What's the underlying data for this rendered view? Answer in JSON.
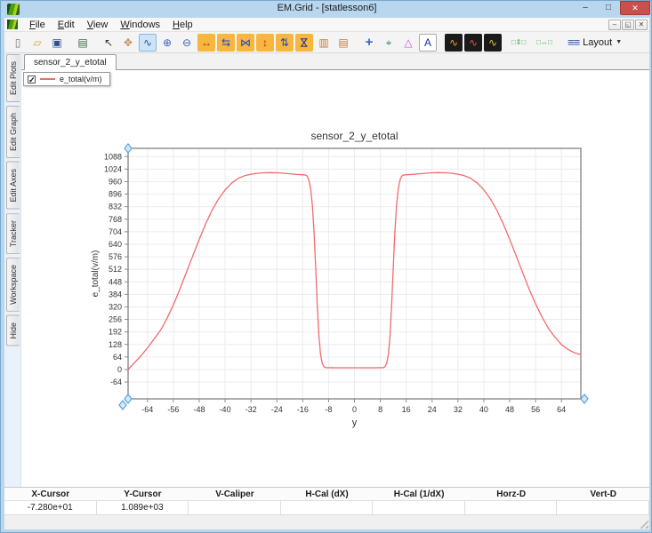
{
  "window": {
    "title": "EM.Grid - [statlesson6]"
  },
  "titlebar": {
    "buttons": [
      {
        "name": "minimize-button",
        "glyph": "–"
      },
      {
        "name": "maximize-button",
        "glyph": "□"
      },
      {
        "name": "close-button",
        "glyph": "✕",
        "close": true
      }
    ]
  },
  "menubar": {
    "items": [
      {
        "label": "File"
      },
      {
        "label": "Edit"
      },
      {
        "label": "View"
      },
      {
        "label": "Windows"
      },
      {
        "label": "Help"
      }
    ],
    "mdi_buttons": [
      {
        "name": "mdi-minimize-button",
        "glyph": "–"
      },
      {
        "name": "mdi-restore-button",
        "glyph": "◱"
      },
      {
        "name": "mdi-close-button",
        "glyph": "✕"
      }
    ]
  },
  "toolbar": {
    "layout_label": "Layout",
    "items": [
      {
        "name": "new-file-icon",
        "glyph": "▯",
        "fg": "#777777"
      },
      {
        "name": "open-folder-icon",
        "glyph": "▱",
        "fg": "#d9a43a"
      },
      {
        "name": "save-icon",
        "glyph": "▣",
        "fg": "#2f4f8f"
      },
      {
        "sep": true
      },
      {
        "name": "print-icon",
        "glyph": "▤",
        "fg": "#356f45"
      },
      {
        "sep": true
      },
      {
        "name": "pointer-icon",
        "glyph": "↖",
        "fg": "#333333"
      },
      {
        "name": "pan-hand-icon",
        "glyph": "✥",
        "fg": "#c09060"
      },
      {
        "name": "zoom-window-icon",
        "glyph": "∿",
        "fg": "#2255aa",
        "sel": true
      },
      {
        "name": "zoom-in-icon",
        "glyph": "⊕",
        "fg": "#3366bb"
      },
      {
        "name": "zoom-out-icon",
        "glyph": "⊖",
        "fg": "#3366bb"
      },
      {
        "name": "h-expand-icon",
        "glyph": "↔",
        "fg": "#bb2222",
        "bg": "#f6b73c"
      },
      {
        "name": "h-arrows-icon",
        "glyph": "⇆",
        "fg": "#2244cc",
        "bg": "#f6b73c"
      },
      {
        "name": "h-compress-icon",
        "glyph": "⋈",
        "fg": "#2244cc",
        "bg": "#f6b73c"
      },
      {
        "name": "v-expand-icon",
        "glyph": "↕",
        "fg": "#bb2222",
        "bg": "#f6b73c"
      },
      {
        "name": "v-arrows-icon",
        "glyph": "⇅",
        "fg": "#2244cc",
        "bg": "#f6b73c"
      },
      {
        "name": "v-compress-icon",
        "glyph": "⋈",
        "fg": "#223388",
        "bg": "#f6b73c",
        "rot": 90
      },
      {
        "name": "v-panels-icon",
        "glyph": "▥",
        "fg": "#cc7733"
      },
      {
        "name": "h-panels-icon",
        "glyph": "▤",
        "fg": "#cc7733"
      },
      {
        "sep": true
      },
      {
        "name": "crosshair-icon",
        "glyph": "+",
        "fg": "#3366cc",
        "big": true
      },
      {
        "name": "tracker-axes-icon",
        "glyph": "⌖",
        "fg": "#2a8a4a"
      },
      {
        "name": "caliper-triangle-icon",
        "glyph": "△",
        "fg": "#cc55cc"
      },
      {
        "name": "text-label-icon",
        "glyph": "A",
        "fg": "#223388",
        "bg": "#ffffff",
        "border": "#aaaaaa"
      },
      {
        "sep": true
      },
      {
        "name": "copy-plot-icon",
        "glyph": "∿",
        "fg": "#f0a030",
        "bg": "#1a1a1a"
      },
      {
        "name": "plot-red-icon",
        "glyph": "∿",
        "fg": "#e05555",
        "bg": "#1a1a1a"
      },
      {
        "name": "plot-yellow-icon",
        "glyph": "∿",
        "fg": "#d8c84a",
        "bg": "#1a1a1a"
      },
      {
        "sep": true
      },
      {
        "name": "v-spacing-icon",
        "glyph": "□⇕□",
        "fg": "#44aa44",
        "small": true
      },
      {
        "sep": true
      },
      {
        "name": "h-spacing-icon",
        "glyph": "□↔□",
        "fg": "#44aa44",
        "small": true
      },
      {
        "sep": true
      }
    ]
  },
  "tabs": {
    "active": "sensor_2_y_etotal"
  },
  "sidebar": {
    "items": [
      "Edit Plots",
      "Edit Graph",
      "Edit Axes",
      "Tracker",
      "Workspace",
      "Hide"
    ]
  },
  "legend": {
    "checked": "✓",
    "label": "e_total(v/m)",
    "line_color": "#f26b6b"
  },
  "chart_data": {
    "type": "line",
    "title": "sensor_2_y_etotal",
    "xlabel": "y",
    "ylabel": "e_total(v/m)",
    "xlim": [
      -70,
      70
    ],
    "ylim": [
      -150,
      1130
    ],
    "x_ticks": [
      -64,
      -56,
      -48,
      -40,
      -32,
      -24,
      -16,
      -8,
      0,
      8,
      16,
      24,
      32,
      40,
      48,
      56,
      64
    ],
    "y_ticks": [
      -64,
      0,
      64,
      128,
      192,
      256,
      320,
      384,
      448,
      512,
      576,
      640,
      704,
      768,
      832,
      896,
      960,
      1024,
      1088
    ],
    "grid": true,
    "legend_position": "top-left-floating",
    "frame_color": "#8a8a8a",
    "grid_color": "#ebebf2",
    "marker_color": "#5aa2e0",
    "corner_markers": [
      "top-left",
      "bottom-left",
      "bottom-left-outer",
      "bottom-right"
    ],
    "series": [
      {
        "name": "e_total(v/m)",
        "color": "#f26b6b",
        "points": [
          [
            -70,
            0
          ],
          [
            -68,
            35
          ],
          [
            -66,
            70
          ],
          [
            -64,
            110
          ],
          [
            -62,
            155
          ],
          [
            -60,
            200
          ],
          [
            -58,
            260
          ],
          [
            -56,
            330
          ],
          [
            -54,
            410
          ],
          [
            -52,
            495
          ],
          [
            -50,
            580
          ],
          [
            -48,
            665
          ],
          [
            -46,
            745
          ],
          [
            -44,
            815
          ],
          [
            -42,
            872
          ],
          [
            -40,
            918
          ],
          [
            -38,
            952
          ],
          [
            -36,
            976
          ],
          [
            -34,
            990
          ],
          [
            -32,
            998
          ],
          [
            -30,
            1003
          ],
          [
            -28,
            1005
          ],
          [
            -26,
            1006
          ],
          [
            -24,
            1005
          ],
          [
            -22,
            1003
          ],
          [
            -20,
            1000
          ],
          [
            -18,
            997
          ],
          [
            -16,
            995
          ],
          [
            -15,
            993
          ],
          [
            -14.5,
            985
          ],
          [
            -14,
            963
          ],
          [
            -13.5,
            918
          ],
          [
            -13,
            838
          ],
          [
            -12.5,
            700
          ],
          [
            -12,
            520
          ],
          [
            -11.5,
            330
          ],
          [
            -11,
            175
          ],
          [
            -10.5,
            80
          ],
          [
            -10,
            34
          ],
          [
            -9.5,
            16
          ],
          [
            -9,
            10
          ],
          [
            -6,
            9
          ],
          [
            0,
            9
          ],
          [
            6,
            9
          ],
          [
            9,
            10
          ],
          [
            9.5,
            16
          ],
          [
            10,
            34
          ],
          [
            10.5,
            80
          ],
          [
            11,
            175
          ],
          [
            11.5,
            330
          ],
          [
            12,
            520
          ],
          [
            12.5,
            700
          ],
          [
            13,
            838
          ],
          [
            13.5,
            918
          ],
          [
            14,
            963
          ],
          [
            14.5,
            985
          ],
          [
            15,
            993
          ],
          [
            16,
            995
          ],
          [
            18,
            997
          ],
          [
            20,
            1000
          ],
          [
            22,
            1003
          ],
          [
            24,
            1005
          ],
          [
            26,
            1006
          ],
          [
            28,
            1005
          ],
          [
            30,
            1003
          ],
          [
            32,
            998
          ],
          [
            34,
            990
          ],
          [
            36,
            976
          ],
          [
            38,
            952
          ],
          [
            40,
            918
          ],
          [
            42,
            872
          ],
          [
            44,
            815
          ],
          [
            46,
            745
          ],
          [
            48,
            665
          ],
          [
            50,
            580
          ],
          [
            52,
            495
          ],
          [
            54,
            412
          ],
          [
            56,
            335
          ],
          [
            58,
            268
          ],
          [
            60,
            210
          ],
          [
            62,
            165
          ],
          [
            64,
            128
          ],
          [
            66,
            103
          ],
          [
            68,
            86
          ],
          [
            70,
            76
          ]
        ]
      }
    ]
  },
  "status_table": {
    "headers": [
      "X-Cursor",
      "Y-Cursor",
      "V-Caliper",
      "H-Cal (dX)",
      "H-Cal (1/dX)",
      "Horz-D",
      "Vert-D"
    ],
    "values": [
      "-7.280e+01",
      "1.089e+03",
      "",
      "",
      "",
      "",
      ""
    ]
  }
}
